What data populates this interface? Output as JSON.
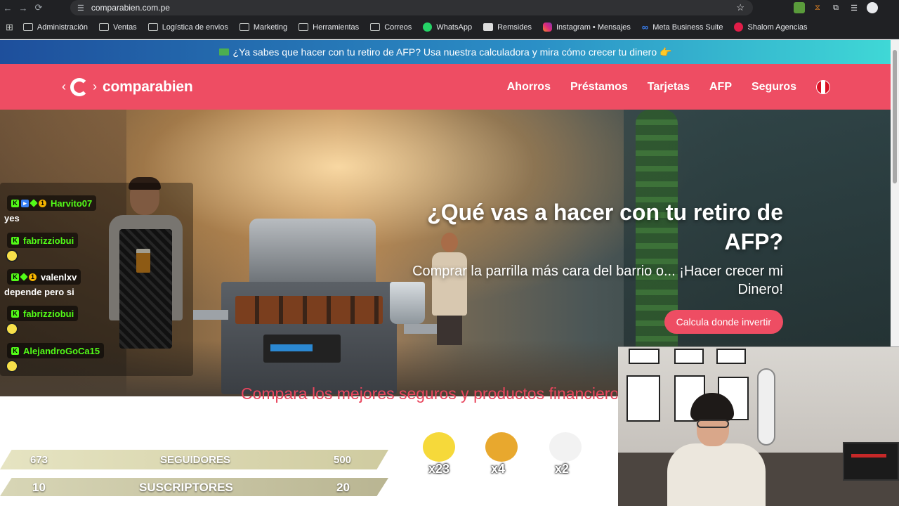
{
  "browser": {
    "url": "comparabien.com.pe",
    "bookmarks": [
      "Administración",
      "Ventas",
      "Logística de envios",
      "Marketing",
      "Herramientas",
      "Correos",
      "WhatsApp",
      "Remsides",
      "Instagram • Mensajes",
      "Meta Business Suite",
      "Shalom Agencias"
    ]
  },
  "promo": {
    "text": "¿Ya sabes que hacer con tu retiro de AFP? Usa nuestra calculadora y mira cómo crecer tu dinero 👉"
  },
  "header": {
    "logo_text": "comparabien",
    "menu": [
      "Ahorros",
      "Préstamos",
      "Tarjetas",
      "AFP",
      "Seguros"
    ]
  },
  "hero": {
    "title": "¿Qué vas a hacer con tu retiro de AFP?",
    "subtitle": "Comprar la parrilla más cara del barrio o... ¡Hacer crecer mi Dinero!",
    "cta": "Calcula donde invertir"
  },
  "section": {
    "title": "Compara los mejores seguros y productos financieros"
  },
  "stream": {
    "chat": [
      {
        "user": "Harvito07",
        "text": "yes"
      },
      {
        "user": "fabrizziobui",
        "text": ""
      },
      {
        "user": "valenlxv",
        "text": "depende pero si"
      },
      {
        "user": "fabrizziobui",
        "text": ""
      },
      {
        "user": "AlejandroGoCa15",
        "text": ""
      }
    ],
    "followers": {
      "current": "673",
      "label": "SEGUIDORES",
      "goal": "500"
    },
    "subscribers": {
      "current": "10",
      "label": "SUSCRIPTORES",
      "goal": "20"
    },
    "gifts": [
      "x23",
      "x4",
      "x2"
    ]
  }
}
